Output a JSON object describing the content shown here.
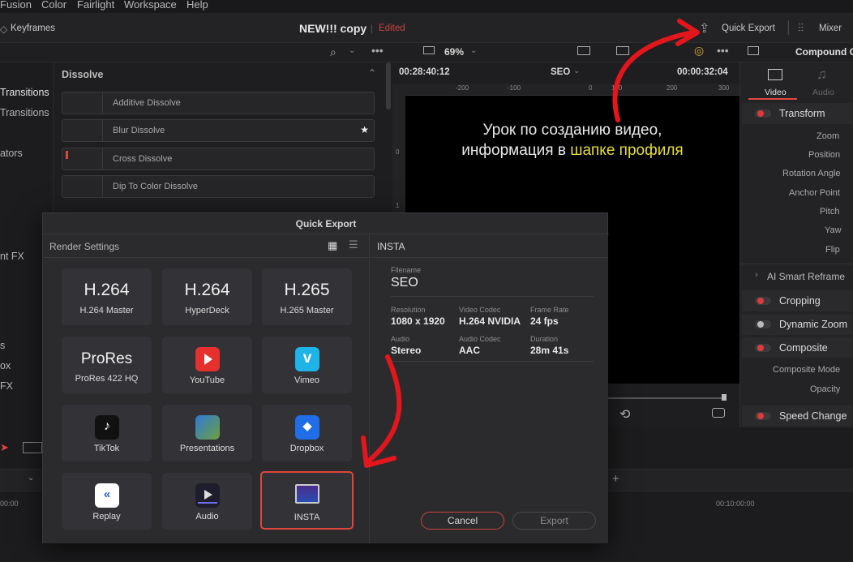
{
  "menu": [
    "Fusion",
    "Color",
    "Fairlight",
    "Workspace",
    "Help"
  ],
  "titlebar": {
    "keyframes": "Keyframes",
    "project": "NEW!!! copy",
    "status": "Edited",
    "quick_export": "Quick Export",
    "mixer": "Mixer"
  },
  "toolbar": {
    "zoom": "69%",
    "compound": "Compound C"
  },
  "left_strip": [
    "Transitions",
    "Transitions",
    "ators",
    "nt FX",
    "s",
    "ox",
    "FX"
  ],
  "effects": {
    "header": "Dissolve",
    "items": [
      "Additive Dissolve",
      "Blur Dissolve",
      "Cross Dissolve",
      "Dip To Color Dissolve"
    ]
  },
  "viewer": {
    "timecode_left": "00:28:40:12",
    "clip": "SEO",
    "timecode_right": "00:00:32:04",
    "ruler": [
      "-200",
      "-100",
      "0",
      "100",
      "200",
      "300"
    ],
    "vruler": [
      "0",
      "1"
    ],
    "caption_line1": "Урок по созданию видео,",
    "caption_line2_a": "информация в ",
    "caption_line2_b": "шапке профиля"
  },
  "inspector": {
    "tab_video": "Video",
    "tab_audio": "Audio",
    "transform": "Transform",
    "params": [
      "Zoom",
      "Position",
      "Rotation Angle",
      "Anchor Point",
      "Pitch",
      "Yaw",
      "Flip"
    ],
    "ai_smart_reframe": "AI Smart Reframe",
    "cropping": "Cropping",
    "dynamic_zoom": "Dynamic Zoom",
    "composite": "Composite",
    "composite_mode": "Composite Mode",
    "opacity": "Opacity",
    "speed_change": "Speed Change"
  },
  "timeline": {
    "tc_left": "00:00",
    "tc_right": "00:10:00:00"
  },
  "dialog": {
    "title": "Quick Export",
    "render_settings": "Render Settings",
    "tiles": [
      {
        "big": "H.264",
        "label": "H.264 Master"
      },
      {
        "big": "H.264",
        "label": "HyperDeck"
      },
      {
        "big": "H.265",
        "label": "H.265 Master"
      },
      {
        "big": "ProRes",
        "label": "ProRes 422 HQ"
      },
      {
        "label": "YouTube",
        "icon": "youtube-icon"
      },
      {
        "label": "Vimeo",
        "icon": "vimeo-icon"
      },
      {
        "label": "TikTok",
        "icon": "tiktok-icon"
      },
      {
        "label": "Presentations",
        "icon": "presentations-icon"
      },
      {
        "label": "Dropbox",
        "icon": "dropbox-icon"
      },
      {
        "label": "Replay",
        "icon": "replay-icon"
      },
      {
        "label": "Audio",
        "icon": "audio-icon"
      },
      {
        "label": "INSTA",
        "icon": "monitor-icon"
      }
    ],
    "preset_name": "INSTA",
    "filename_label": "Filename",
    "filename": "SEO",
    "resolution_label": "Resolution",
    "resolution": "1080 x 1920",
    "codec_label": "Video Codec",
    "codec": "H.264 NVIDIA",
    "fps_label": "Frame Rate",
    "fps": "24 fps",
    "audio_label": "Audio",
    "audio": "Stereo",
    "acodec_label": "Audio Codec",
    "acodec": "AAC",
    "duration_label": "Duration",
    "duration": "28m 41s",
    "cancel": "Cancel",
    "export": "Export"
  },
  "colors": {
    "accent": "#e0463e",
    "yellow_text": "#e6dc3a",
    "annotation_arrow": "#e3161c"
  }
}
